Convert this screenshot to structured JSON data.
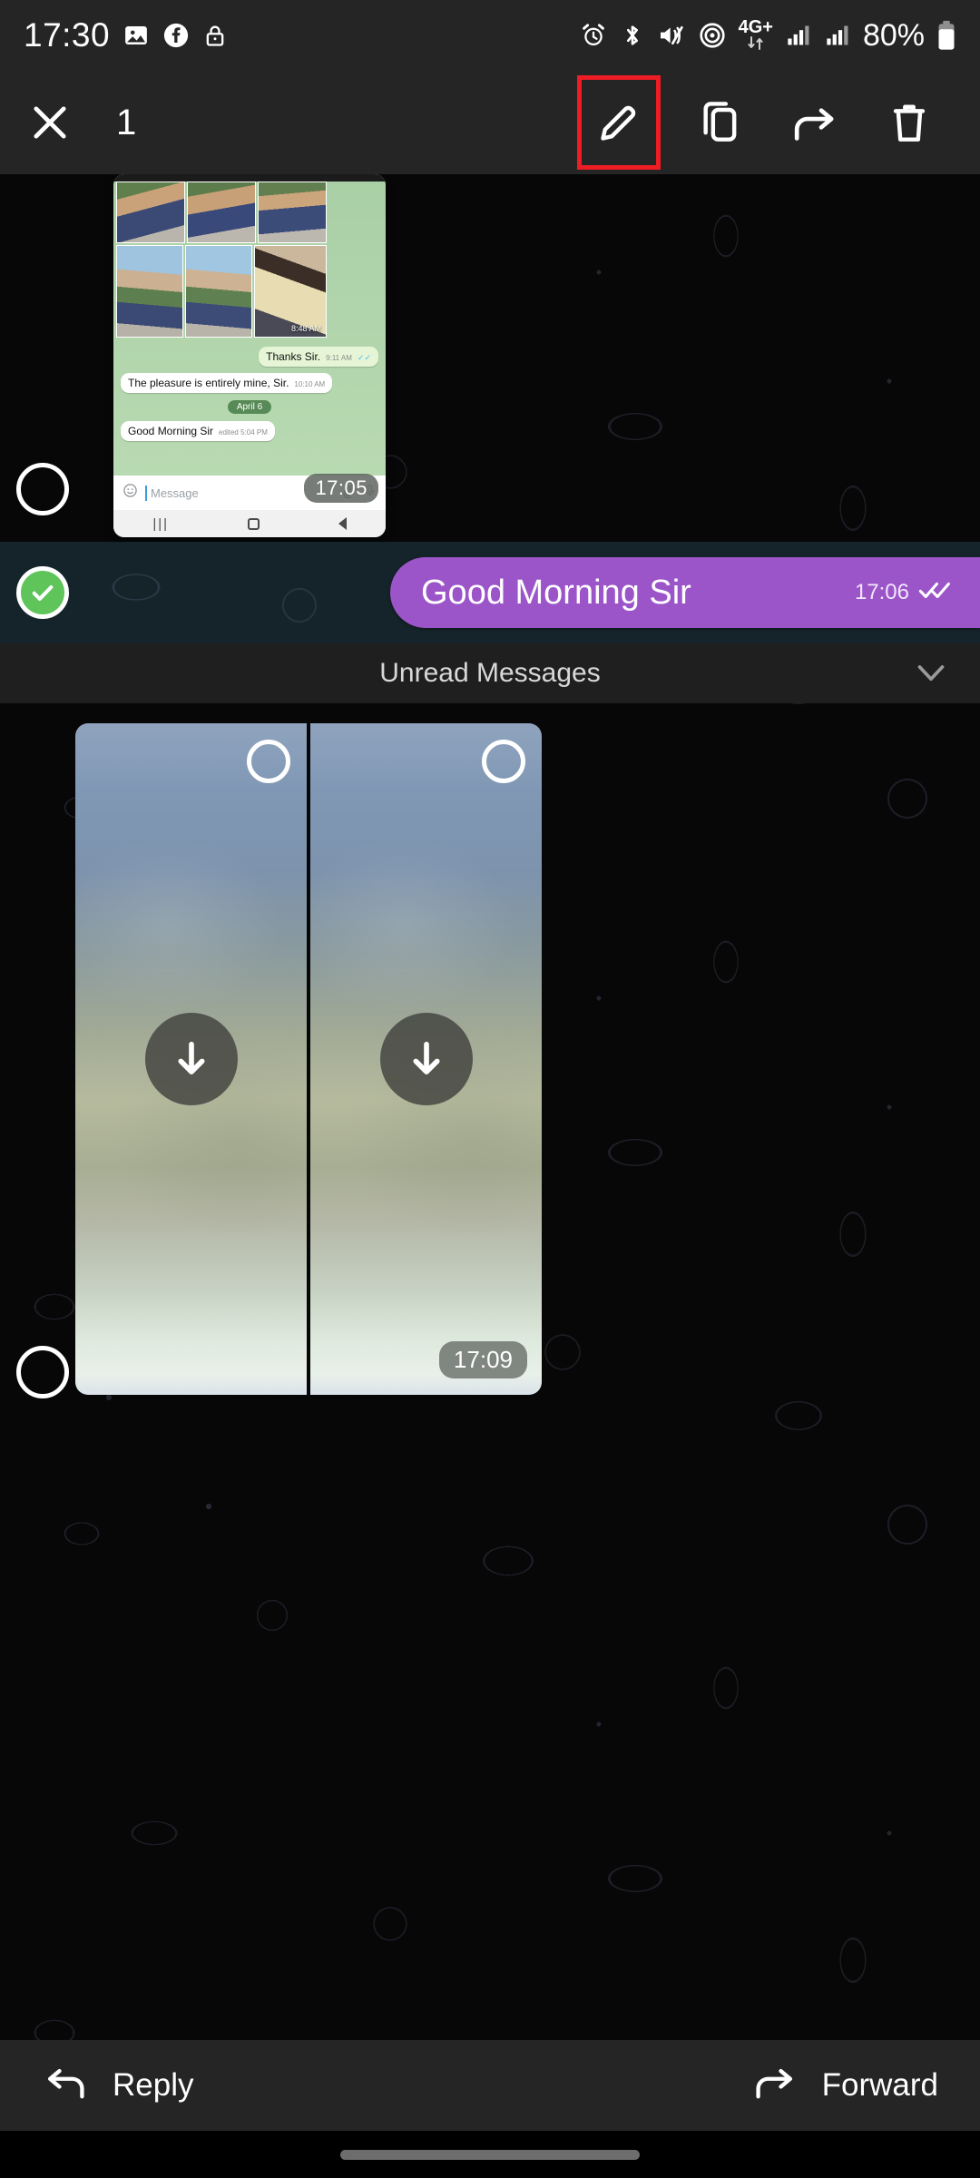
{
  "status_bar": {
    "time": "17:30",
    "battery_percent": "80%",
    "network_label": "4G+",
    "left_icons": [
      "photos-icon",
      "facebook-icon",
      "lock-icon"
    ],
    "right_icons": [
      "alarm-icon",
      "bluetooth-icon",
      "mute-icon",
      "hotspot-icon",
      "network-4gplus-icon",
      "signal-bars-icon-1",
      "signal-bars-icon-2",
      "battery-icon"
    ]
  },
  "toolbar": {
    "close_label": "close-icon",
    "selection_count": "1",
    "actions": [
      {
        "name": "edit-button",
        "icon": "pencil-icon",
        "highlighted": true
      },
      {
        "name": "copy-button",
        "icon": "copy-icon",
        "highlighted": false
      },
      {
        "name": "forward-button",
        "icon": "forward-arrow-icon",
        "highlighted": false
      },
      {
        "name": "delete-button",
        "icon": "trash-icon",
        "highlighted": false
      }
    ],
    "highlight_color": "#ee1c25"
  },
  "chat": {
    "shared_screenshot": {
      "timestamp_overlay": "17:05",
      "photo_grid_time": "8:48 AM",
      "messages": [
        {
          "text": "Thanks Sir.",
          "time": "9:11 AM",
          "ticks": "✓✓",
          "side": "out"
        },
        {
          "text": "The pleasure is entirely mine, Sir.",
          "time": "10:10 AM",
          "ticks": "",
          "side": "in"
        },
        {
          "text": "Good Morning Sir",
          "time": "edited 5:04 PM",
          "ticks": "",
          "side": "in"
        }
      ],
      "day_divider": "April 6",
      "input_placeholder": "Message",
      "input_icons": [
        "emoji-icon",
        "attachment-icon",
        "microphone-icon"
      ],
      "nav_icons": [
        "recents-icon",
        "home-icon",
        "back-icon"
      ],
      "selected": false
    },
    "selected_message": {
      "text": "Good Morning Sir",
      "time": "17:06",
      "ticks": "✓✓",
      "bubble_color": "#9b55c9",
      "selected": true
    },
    "unread_divider": {
      "label": "Unread Messages",
      "chevron": "chevron-down-icon"
    },
    "media_message": {
      "time": "17:09",
      "selected": false,
      "items": [
        {
          "name": "media-thumbnail-1",
          "checkbox": "unchecked",
          "action": "download-icon"
        },
        {
          "name": "media-thumbnail-2",
          "checkbox": "unchecked",
          "action": "download-icon"
        }
      ]
    }
  },
  "action_bar": {
    "reply_label": "Reply",
    "reply_icon": "reply-arrow-icon",
    "forward_label": "Forward",
    "forward_icon": "forward-arrow-icon"
  },
  "theme": {
    "background": "#070708",
    "bar_background": "#252525",
    "selection_row_background": "#15232a",
    "accent_purple": "#9b55c9",
    "accent_green": "#5fc45a"
  }
}
